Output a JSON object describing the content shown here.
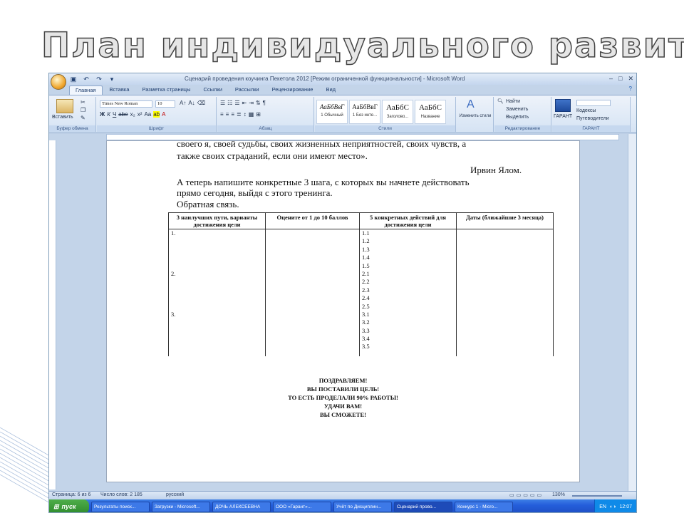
{
  "slide": {
    "title": "План индивидуального развития"
  },
  "window": {
    "title": "Сценарий проведения коучинга Пекетола 2012 [Режим ограниченной функциональности] - Microsoft Word"
  },
  "ribbon": {
    "tabs": [
      "Главная",
      "Вставка",
      "Разметка страницы",
      "Ссылки",
      "Рассылки",
      "Рецензирование",
      "Вид"
    ],
    "clipboard": {
      "paste_label": "Вставить",
      "group_label": "Буфер обмена"
    },
    "font": {
      "font_name": "Times New Roman",
      "font_size": "10",
      "group_label": "Шрифт",
      "format_buttons": [
        "Ж",
        "К",
        "Ч",
        "abe",
        "x₂",
        "x²",
        "Aa"
      ]
    },
    "paragraph": {
      "group_label": "Абзац"
    },
    "styles": {
      "items": [
        {
          "sample": "АаБбВвГ",
          "name": "1 Обычный"
        },
        {
          "sample": "АаБбВвГ",
          "name": "1 Без инте..."
        },
        {
          "sample": "АаБбС",
          "name": "Заголово..."
        },
        {
          "sample": "АаБбС",
          "name": "Название"
        }
      ],
      "change_styles_label": "Изменить стили",
      "group_label": "Стили"
    },
    "editing": {
      "find_label": "Найти",
      "replace_label": "Заменить",
      "select_label": "Выделить",
      "group_label": "Редактирование"
    },
    "garant": {
      "button_label": "ГАРАНТ",
      "codex_label": "Кодексы",
      "guide_label": "Путеводители",
      "group_label": "ГАРАНТ"
    }
  },
  "document": {
    "line1": "своего я, своей судьбы, своих жизненных неприятностей, своих чувств, а",
    "line2": "также своих страданий, если они имеют место».",
    "author": "Ирвин Ялом.",
    "line3": "А теперь напишите конкретные 3 шага, с которых вы начнете действовать",
    "line4": "прямо сегодня, выйдя с этого тренинга.",
    "line5": "Обратная связь.",
    "table": {
      "headers": [
        "3 наилучших пути, варианты достижения цели",
        "Оцените от 1 до 10 баллов",
        "5 конкретных действий для достижения цели",
        "Даты (ближайшие 3 месяца)"
      ],
      "col1_items": [
        "1.",
        "",
        "",
        "",
        "",
        "2.",
        "",
        "",
        "",
        "",
        "3.",
        "",
        "",
        "",
        ""
      ],
      "col3_items": [
        "1.1",
        "1.2",
        "1.3",
        "1.4",
        "1.5",
        "2.1",
        "2.2",
        "2.3",
        "2.4",
        "2.5",
        "3.1",
        "3.2",
        "3.3",
        "3.4",
        "3.5"
      ]
    },
    "congrats": [
      "ПОЗДРАВЛЯЕМ!",
      "ВЫ ПОСТАВИЛИ ЦЕЛЬ!",
      "ТО ЕСТЬ ПРОДЕЛАЛИ 90% РАБОТЫ!",
      "УДАЧИ ВАМ!",
      "ВЫ СМОЖЕТЕ!"
    ]
  },
  "statusbar": {
    "page": "Страница: 6 из 6",
    "words": "Число слов: 2 185",
    "language": "русский",
    "zoom": "130%"
  },
  "taskbar": {
    "start_label": "пуск",
    "tasks": [
      "Результаты поиск...",
      "Загрузки - Microsoft...",
      "ДОЧЬ АЛЕКСЕЕВНА",
      "ООО «Гарант»...",
      "Учёт по Дисциплин...",
      "Сценарий прово...",
      "Конкурс 1 - Micro..."
    ],
    "lang": "EN",
    "clock": "12:07"
  }
}
